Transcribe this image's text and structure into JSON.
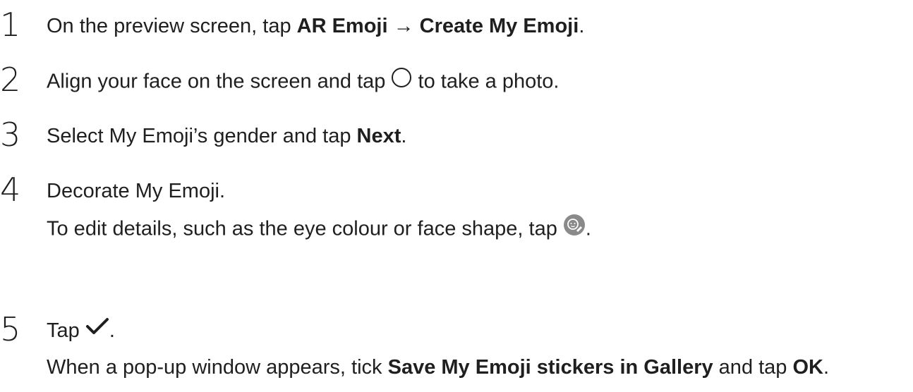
{
  "steps": [
    {
      "number": "1",
      "prefix": "On the preview screen, tap ",
      "bold1": "AR Emoji",
      "arrow": " → ",
      "bold2": "Create My Emoji",
      "suffix": "."
    },
    {
      "number": "2",
      "prefix": "Align your face on the screen and tap ",
      "icon": "shutter-circle-icon",
      "suffix": " to take a photo."
    },
    {
      "number": "3",
      "prefix": "Select My Emoji’s gender and tap ",
      "bold1": "Next",
      "suffix": "."
    },
    {
      "number": "4",
      "text": "Decorate My Emoji.",
      "sub_prefix": "To edit details, such as the eye colour or face shape, tap ",
      "sub_icon": "face-edit-icon",
      "sub_suffix": "."
    },
    {
      "number": "5",
      "prefix": "Tap ",
      "icon": "checkmark-icon",
      "suffix": ".",
      "sub_prefix": "When a pop-up window appears, tick ",
      "sub_bold1": "Save My Emoji stickers in Gallery",
      "sub_mid": " and tap ",
      "sub_bold2": "OK",
      "sub_suffix": "."
    }
  ]
}
